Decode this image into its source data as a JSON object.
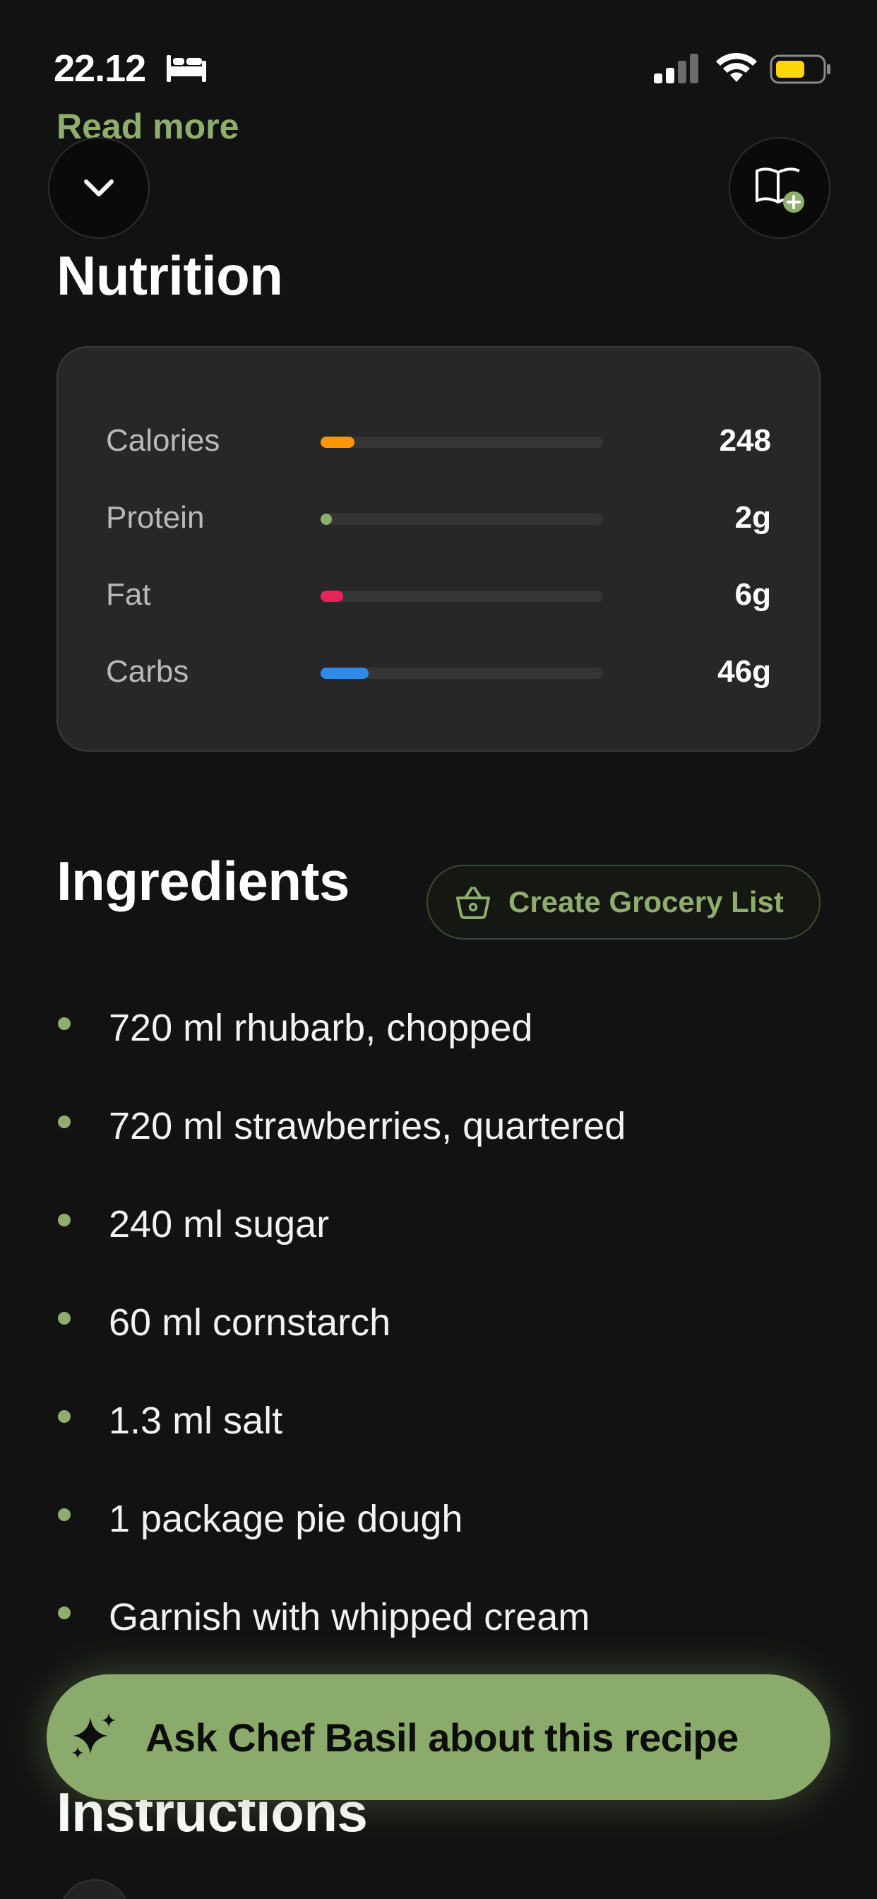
{
  "status_bar": {
    "time": "22.12",
    "icons": [
      "bed-icon",
      "cellular-signal-icon",
      "wifi-icon",
      "battery-icon"
    ],
    "battery_color": "#FFD60A"
  },
  "read_more": "Read more",
  "nav": {
    "collapse_icon": "chevron-down-icon",
    "save_icon": "book-add-icon"
  },
  "nutrition": {
    "title": "Nutrition",
    "items": [
      {
        "label": "Calories",
        "value": "248",
        "fill_fraction": 0.12,
        "color": "#FF9500"
      },
      {
        "label": "Protein",
        "value": "2g",
        "fill_fraction": 0.02,
        "color": "#8FAE6E"
      },
      {
        "label": "Fat",
        "value": "6g",
        "fill_fraction": 0.08,
        "color": "#E8245C"
      },
      {
        "label": "Carbs",
        "value": "46g",
        "fill_fraction": 0.17,
        "color": "#2D8CEB"
      }
    ]
  },
  "ingredients": {
    "title": "Ingredients",
    "grocery_button": "Create Grocery List",
    "items": [
      "720 ml rhubarb, chopped",
      "720 ml strawberries, quartered",
      "240 ml sugar",
      "60 ml cornstarch",
      "1.3 ml salt",
      "1 package pie dough",
      "Garnish with whipped cream"
    ]
  },
  "ask_chef": {
    "label": "Ask Chef Basil about this recipe",
    "icon": "sparkles-icon"
  },
  "instructions": {
    "title": "Instructions"
  },
  "colors": {
    "background": "#121212",
    "accent": "#8FAE6E",
    "card": "#272727"
  }
}
